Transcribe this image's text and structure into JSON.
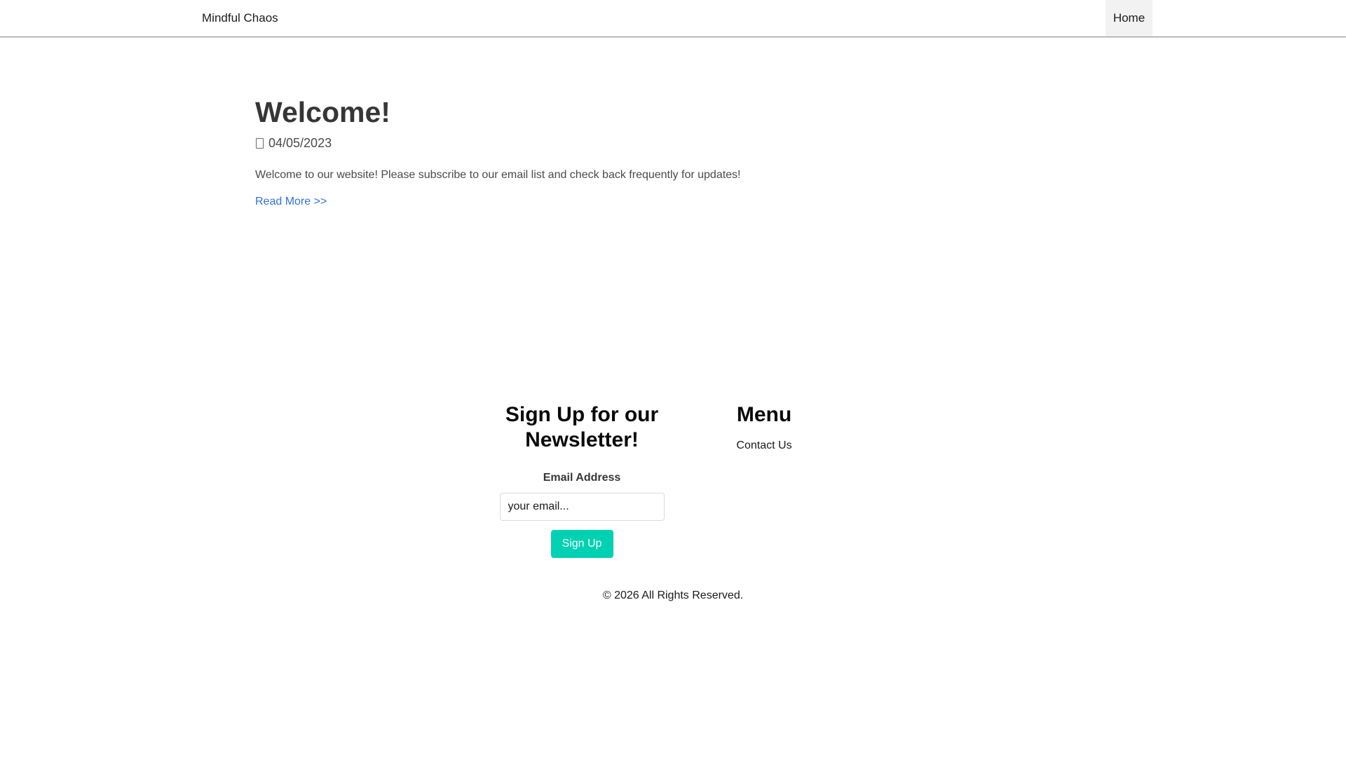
{
  "navbar": {
    "brand": "Mindful Chaos",
    "home_label": "Home"
  },
  "article": {
    "title": "Welcome!",
    "date": "04/05/2023",
    "date_icon": "calendar-icon",
    "body": "Welcome to our website! Please subscribe to our email list and check back frequently for updates!",
    "read_more": "Read More >>"
  },
  "newsletter": {
    "title": "Sign Up for our Newsletter!",
    "email_label": "Email Address",
    "email_placeholder": "your email...",
    "email_value": "",
    "button_label": "Sign Up"
  },
  "menu": {
    "title": "Menu",
    "items": [
      {
        "label": "Contact Us"
      }
    ]
  },
  "footer": {
    "copyright": "© 2026 All Rights Reserved."
  },
  "colors": {
    "accent_button": "#00d1b2",
    "link": "#3273dc",
    "active_nav_bg": "#f2f2f2"
  }
}
